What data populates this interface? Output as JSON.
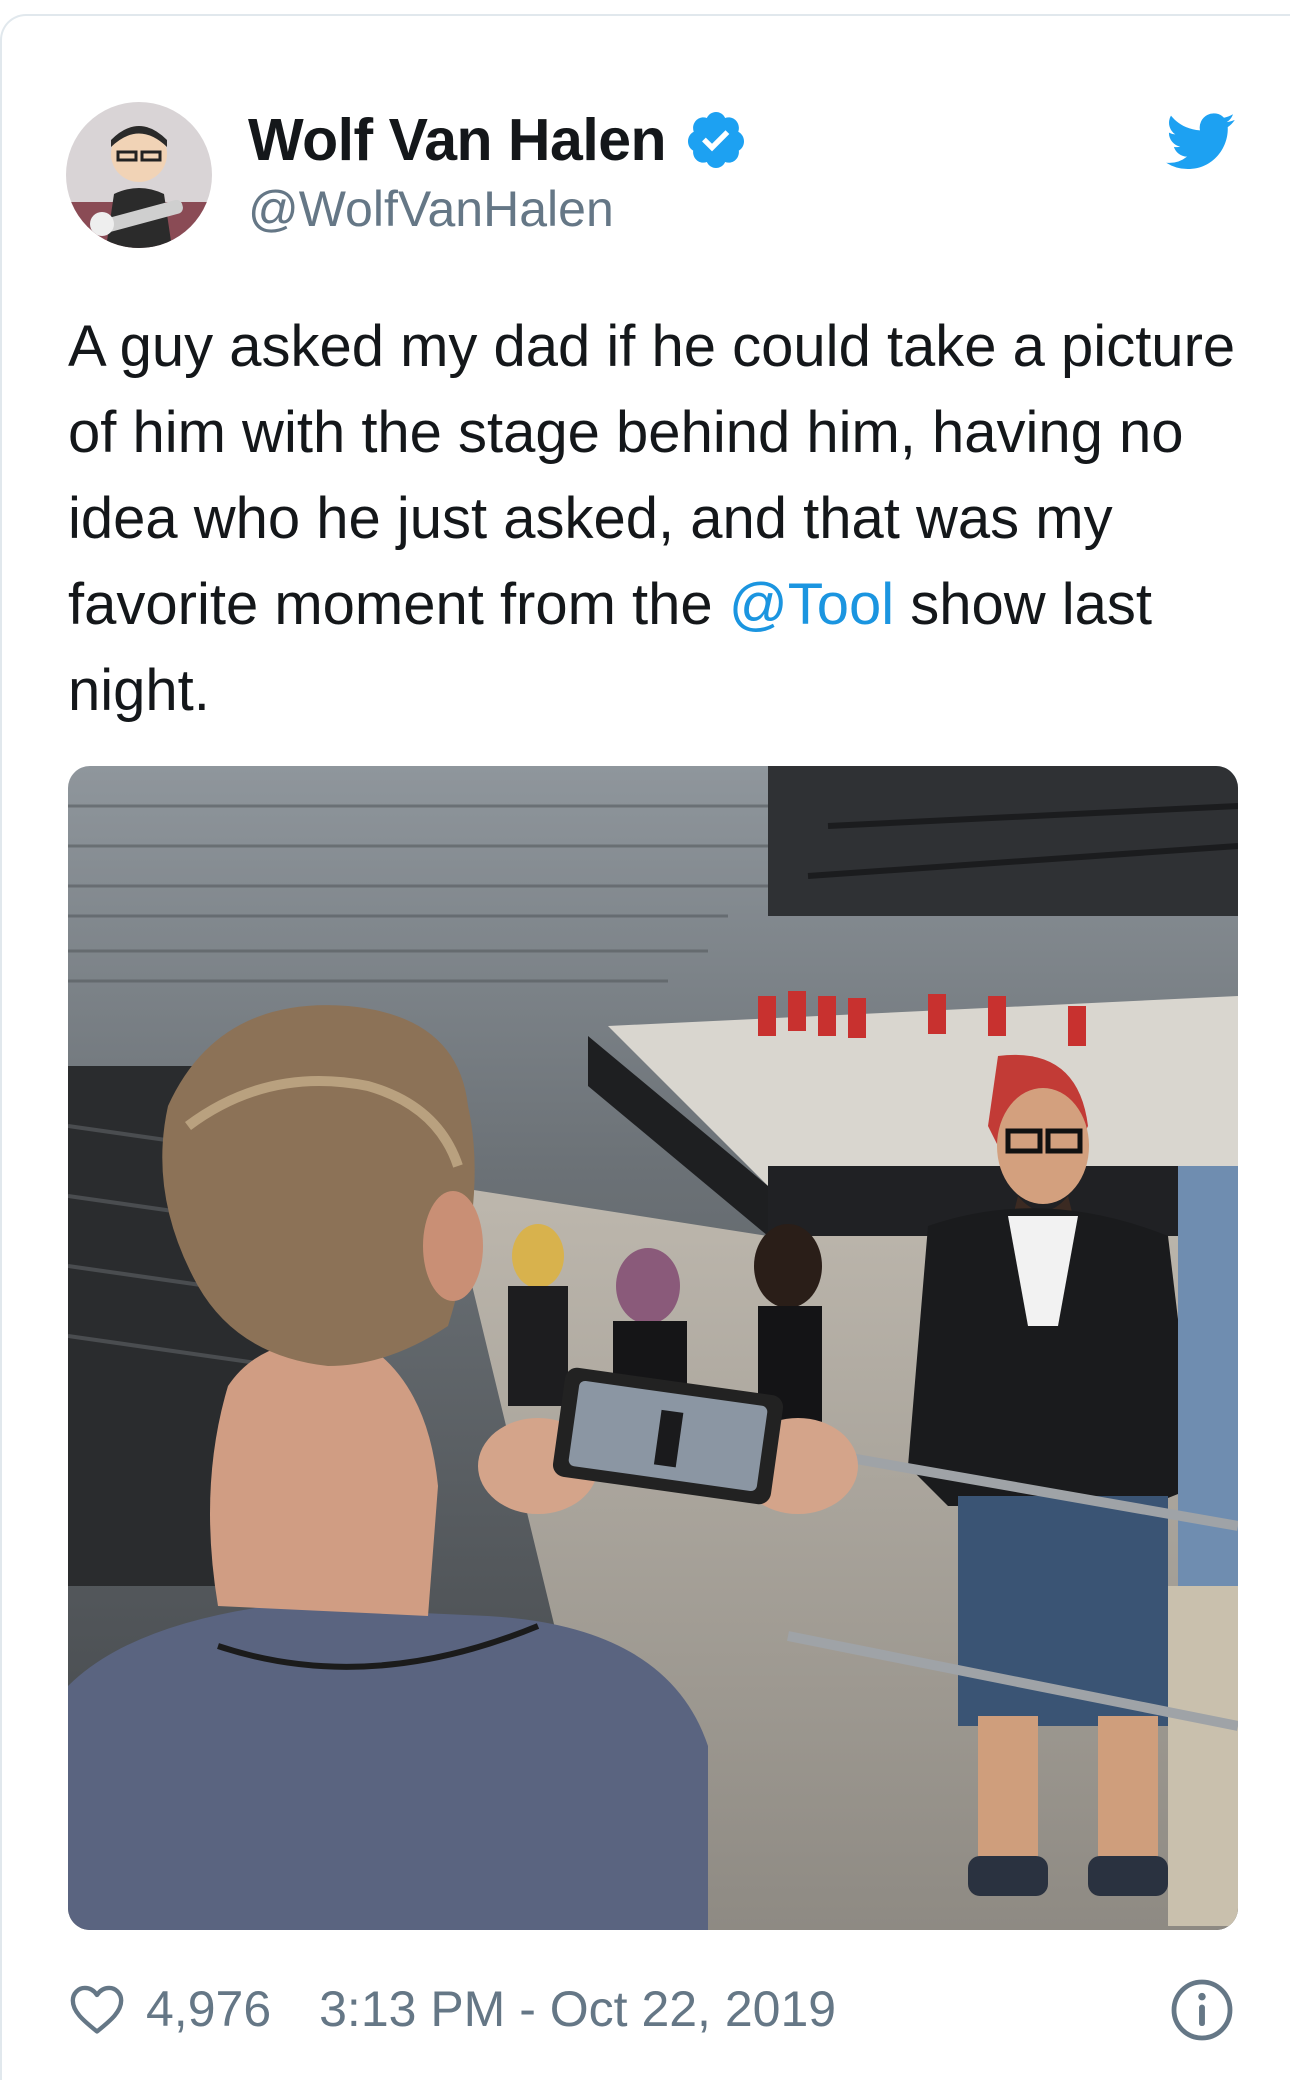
{
  "tweet": {
    "display_name": "Wolf Van Halen",
    "handle": "@WolfVanHalen",
    "text_before_mention": "A guy asked my dad if he could take a picture of him with the stage behind him, having no idea who he just asked, and that was my favorite moment from the ",
    "mention": "@Tool",
    "text_after_mention": " show last night.",
    "likes": "4,976",
    "timestamp": "3:13 PM - Oct 22, 2019"
  },
  "colors": {
    "text": "#14171a",
    "secondary": "#657786",
    "twitter_blue": "#1da1f2",
    "link": "#1b95e0"
  },
  "icons": {
    "verified": "verified-badge-icon",
    "brand": "twitter-bird-icon",
    "like": "heart-icon",
    "info": "info-icon"
  }
}
